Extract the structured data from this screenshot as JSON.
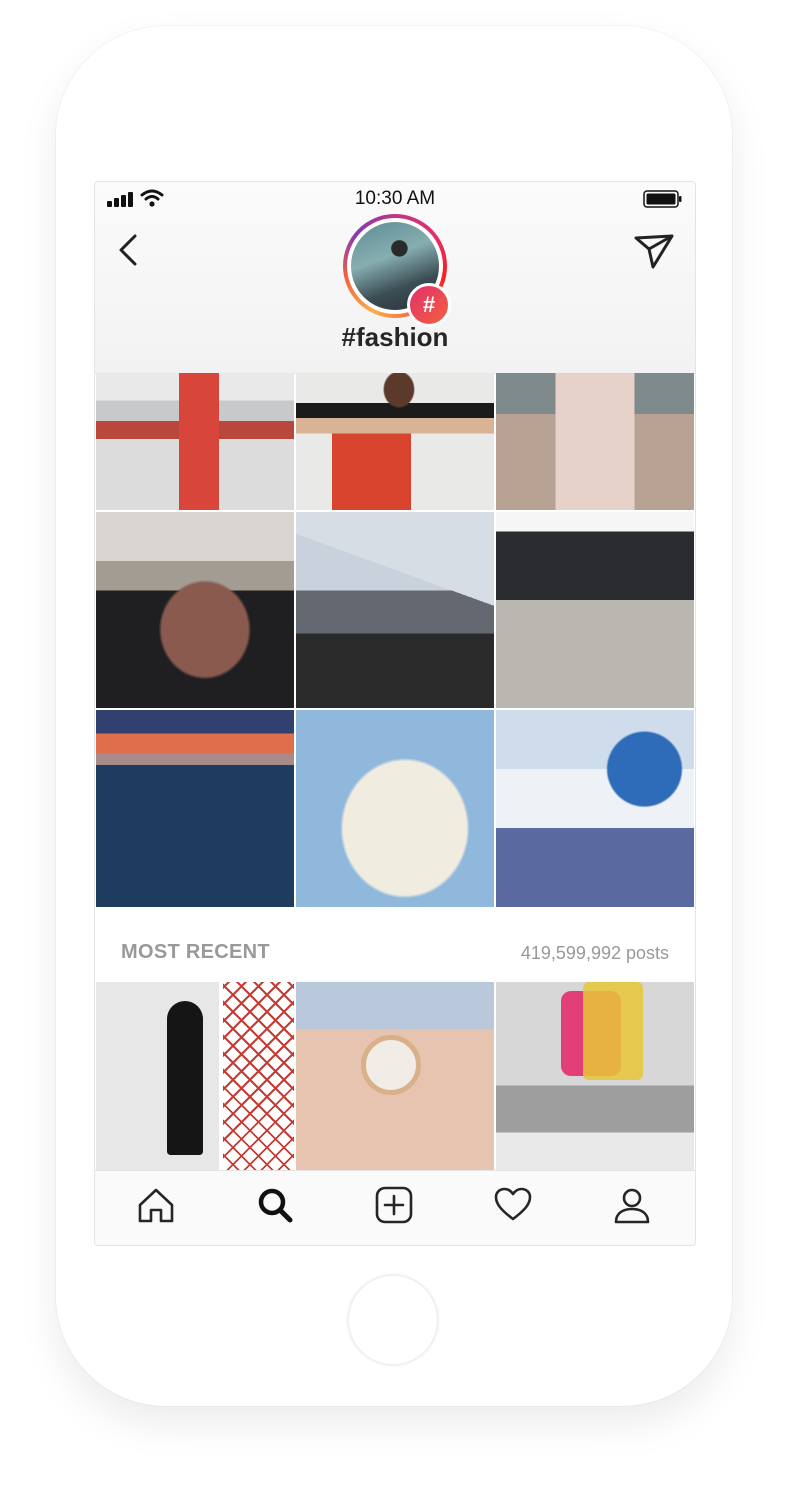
{
  "status_bar": {
    "time": "10:30 AM"
  },
  "header": {
    "hashtag": "#fashion",
    "badge_symbol": "#"
  },
  "icons": {
    "back": "back-arrow-icon",
    "send": "send-icon",
    "signal": "signal-icon",
    "wifi": "wifi-icon",
    "battery": "battery-icon"
  },
  "top_posts": [
    {
      "image": "woman in red dress on balcony"
    },
    {
      "image": "woman in black crop top and floral pants"
    },
    {
      "image": "woman in knit sweater and floral skirt on street"
    },
    {
      "image": "arm holding brown leather clutch"
    },
    {
      "image": "modern house with reflecting pool"
    },
    {
      "image": "woman with shopping bags in front of store"
    },
    {
      "image": "yacht on sea at sunset"
    },
    {
      "image": "woman in floral wrap dress holding straw bag"
    },
    {
      "image": "woman with sunglasses near blue domes"
    }
  ],
  "most_recent": {
    "title": "MOST RECENT",
    "count": "419,599,992 posts",
    "posts": [
      {
        "image": "woman in black outfit against red lattice wall"
      },
      {
        "image": "wrist with rose gold watch"
      },
      {
        "image": "person with pink backpack sitting on concrete"
      }
    ]
  },
  "tab_bar": [
    "home-icon",
    "search-icon",
    "add-post-icon",
    "heart-icon",
    "profile-icon"
  ],
  "colors": {
    "accent_gradient_start": "#e1306c",
    "accent_gradient_end": "#f56040",
    "section_text": "#999999"
  }
}
